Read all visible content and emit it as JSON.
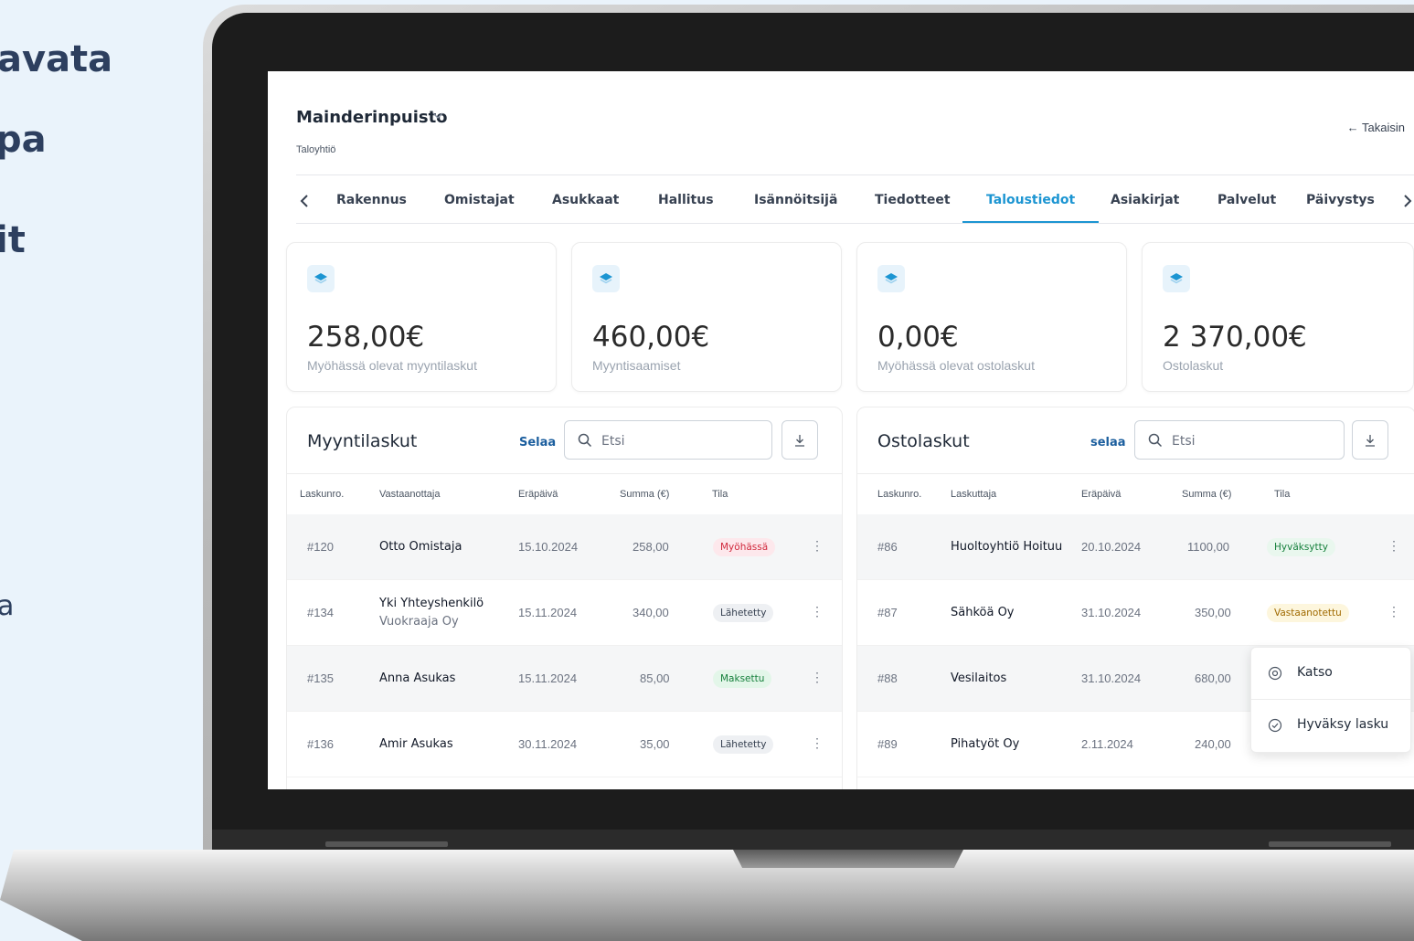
{
  "side_text": [
    "avata",
    "pa",
    "it",
    "a"
  ],
  "header": {
    "property_name": "Mainderinpuisto",
    "property_type": "Taloyhtiö",
    "back_label": "← Takaisin"
  },
  "tabs": [
    {
      "label": "Rakennus",
      "active": false
    },
    {
      "label": "Omistajat",
      "active": false
    },
    {
      "label": "Asukkaat",
      "active": false
    },
    {
      "label": "Hallitus",
      "active": false
    },
    {
      "label": "Isännöitsijä",
      "active": false
    },
    {
      "label": "Tiedotteet",
      "active": false
    },
    {
      "label": "Taloustiedot",
      "active": true
    },
    {
      "label": "Asiakirjat",
      "active": false
    },
    {
      "label": "Palvelut",
      "active": false
    },
    {
      "label": "Päivystys",
      "active": false
    }
  ],
  "stats": [
    {
      "value": "258,00€",
      "label": "Myöhässä olevat myyntilaskut"
    },
    {
      "value": "460,00€",
      "label": "Myyntisaamiset"
    },
    {
      "value": "0,00€",
      "label": "Myöhässä olevat ostolaskut"
    },
    {
      "value": "2 370,00€",
      "label": "Ostolaskut"
    }
  ],
  "sales": {
    "title": "Myyntilaskut",
    "browse_label": "Selaa",
    "search_placeholder": "Etsi",
    "columns": [
      "Laskunro.",
      "Vastaanottaja",
      "Eräpäivä",
      "Summa (€)",
      "Tila"
    ],
    "rows": [
      {
        "no": "#120",
        "name": "Otto Omistaja",
        "sub": "",
        "due": "15.10.2024",
        "sum": "258,00",
        "status": "Myöhässä"
      },
      {
        "no": "#134",
        "name": "Yki Yhteyshenkilö",
        "sub": "Vuokraaja Oy",
        "due": "15.11.2024",
        "sum": "340,00",
        "status": "Lähetetty"
      },
      {
        "no": "#135",
        "name": "Anna Asukas",
        "sub": "",
        "due": "15.11.2024",
        "sum": "85,00",
        "status": "Maksettu"
      },
      {
        "no": "#136",
        "name": "Amir Asukas",
        "sub": "",
        "due": "30.11.2024",
        "sum": "35,00",
        "status": "Lähetetty"
      }
    ]
  },
  "purchases": {
    "title": "Ostolaskut",
    "browse_label": "selaa",
    "search_placeholder": "Etsi",
    "columns": [
      "Laskunro.",
      "Laskuttaja",
      "Eräpäivä",
      "Summa (€)",
      "Tila"
    ],
    "rows": [
      {
        "no": "#86",
        "name": "Huoltoyhtiö Hoituu",
        "due": "20.10.2024",
        "sum": "1100,00",
        "status": "Hyväksytty"
      },
      {
        "no": "#87",
        "name": "Sähköä Oy",
        "due": "31.10.2024",
        "sum": "350,00",
        "status": "Vastaanotettu"
      },
      {
        "no": "#88",
        "name": "Vesilaitos",
        "due": "31.10.2024",
        "sum": "680,00",
        "status": ""
      },
      {
        "no": "#89",
        "name": "Pihatyöt Oy",
        "due": "2.11.2024",
        "sum": "240,00",
        "status": ""
      }
    ]
  },
  "context_menu": {
    "items": [
      {
        "label": "Katso",
        "icon": "eye-icon"
      },
      {
        "label": "Hyväksy lasku",
        "icon": "check-circle-icon"
      }
    ]
  },
  "colors": {
    "accent": "#1c95d2",
    "late": "#d1293d",
    "paid": "#16803c",
    "received": "#a06a00"
  }
}
